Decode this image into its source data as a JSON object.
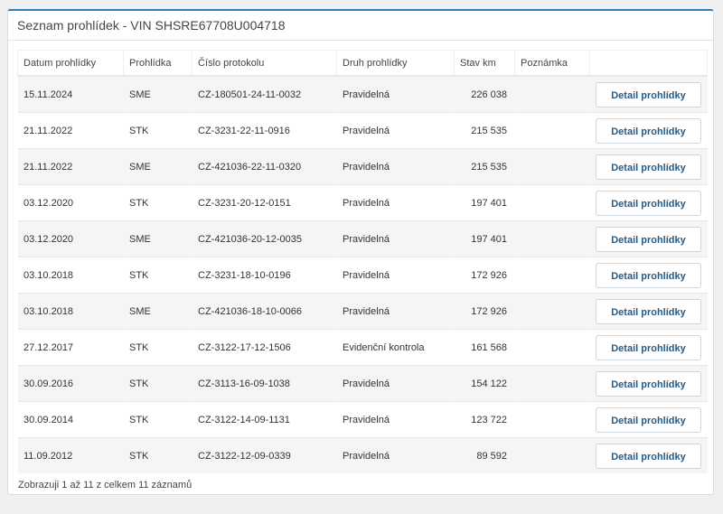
{
  "panel": {
    "title": "Seznam prohlídek - VIN SHSRE67708U004718"
  },
  "table": {
    "headers": [
      "Datum prohlídky",
      "Prohlídka",
      "Číslo protokolu",
      "Druh prohlídky",
      "Stav km",
      "Poznámka",
      ""
    ],
    "rows": [
      {
        "date": "15.11.2024",
        "type": "SME",
        "protocol": "CZ-180501-24-11-0032",
        "kind": "Pravidelná",
        "km": "226 038",
        "note": "",
        "action": "Detail prohlídky"
      },
      {
        "date": "21.11.2022",
        "type": "STK",
        "protocol": "CZ-3231-22-11-0916",
        "kind": "Pravidelná",
        "km": "215 535",
        "note": "",
        "action": "Detail prohlídky"
      },
      {
        "date": "21.11.2022",
        "type": "SME",
        "protocol": "CZ-421036-22-11-0320",
        "kind": "Pravidelná",
        "km": "215 535",
        "note": "",
        "action": "Detail prohlídky"
      },
      {
        "date": "03.12.2020",
        "type": "STK",
        "protocol": "CZ-3231-20-12-0151",
        "kind": "Pravidelná",
        "km": "197 401",
        "note": "",
        "action": "Detail prohlídky"
      },
      {
        "date": "03.12.2020",
        "type": "SME",
        "protocol": "CZ-421036-20-12-0035",
        "kind": "Pravidelná",
        "km": "197 401",
        "note": "",
        "action": "Detail prohlídky"
      },
      {
        "date": "03.10.2018",
        "type": "STK",
        "protocol": "CZ-3231-18-10-0196",
        "kind": "Pravidelná",
        "km": "172 926",
        "note": "",
        "action": "Detail prohlídky"
      },
      {
        "date": "03.10.2018",
        "type": "SME",
        "protocol": "CZ-421036-18-10-0066",
        "kind": "Pravidelná",
        "km": "172 926",
        "note": "",
        "action": "Detail prohlídky"
      },
      {
        "date": "27.12.2017",
        "type": "STK",
        "protocol": "CZ-3122-17-12-1506",
        "kind": "Evidenční kontrola",
        "km": "161 568",
        "note": "",
        "action": "Detail prohlídky"
      },
      {
        "date": "30.09.2016",
        "type": "STK",
        "protocol": "CZ-3113-16-09-1038",
        "kind": "Pravidelná",
        "km": "154 122",
        "note": "",
        "action": "Detail prohlídky"
      },
      {
        "date": "30.09.2014",
        "type": "STK",
        "protocol": "CZ-3122-14-09-1131",
        "kind": "Pravidelná",
        "km": "123 722",
        "note": "",
        "action": "Detail prohlídky"
      },
      {
        "date": "11.09.2012",
        "type": "STK",
        "protocol": "CZ-3122-12-09-0339",
        "kind": "Pravidelná",
        "km": "89 592",
        "note": "",
        "action": "Detail prohlídky"
      }
    ]
  },
  "footer": {
    "info": "Zobrazuji 1 až 11 z celkem 11 záznamů"
  },
  "colors": {
    "accent": "#2f7fb8",
    "button_text": "#2a5a82",
    "row_alt": "#f4f5f6"
  }
}
